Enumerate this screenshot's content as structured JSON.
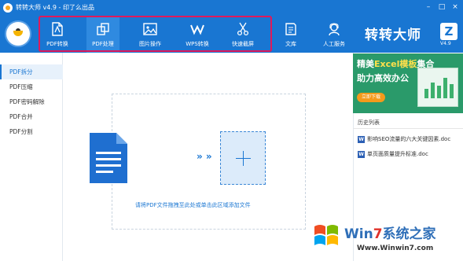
{
  "window": {
    "title": "转转大师 v4.9 - 印了么出品",
    "controls": [
      "–",
      "□",
      "×"
    ]
  },
  "toolbar": {
    "tools": [
      {
        "label": "PDF转换",
        "icon": "pdf-convert-icon"
      },
      {
        "label": "PDF处理",
        "icon": "pdf-process-icon"
      },
      {
        "label": "图片操作",
        "icon": "image-icon"
      },
      {
        "label": "WPS转换",
        "icon": "wps-icon"
      },
      {
        "label": "快速截屏",
        "icon": "scissors-icon"
      },
      {
        "label": "文库",
        "icon": "library-icon"
      },
      {
        "label": "人工服务",
        "icon": "support-icon"
      }
    ],
    "active_tool": "PDF处理",
    "brand": "转转大师",
    "brand_letter": "Z",
    "version": "V4.9",
    "highlight_color": "#e0195a"
  },
  "sidebar": {
    "items": [
      {
        "label": "PDF拆分"
      },
      {
        "label": "PDF压缩"
      },
      {
        "label": "PDF密码解除"
      },
      {
        "label": "PDF合并"
      },
      {
        "label": "PDF分割"
      }
    ],
    "active": "PDF拆分"
  },
  "main": {
    "arrows": "» »",
    "drop_hint": "请将PDF文件拖拽至此处或单击此区域添加文件"
  },
  "ad_banner": {
    "line1_pre": "精美",
    "line1_hl": "Excel模板",
    "line1_post": "集合",
    "line2": "助力高效办公",
    "button": "立即下载"
  },
  "history": {
    "title": "历史列表",
    "items": [
      {
        "name": "影响SEO流量的六大关键因素.doc"
      },
      {
        "name": "单页面质量提升标准.doc"
      }
    ]
  },
  "watermark": {
    "title_pre": "Win",
    "title_num": "7",
    "title_post": "系统之家",
    "url": "Www.Winwin7.com"
  },
  "colors": {
    "primary": "#1976d2",
    "sidebar_active_bg": "#e7f1fb",
    "banner_bg": "#2a9a6a"
  }
}
